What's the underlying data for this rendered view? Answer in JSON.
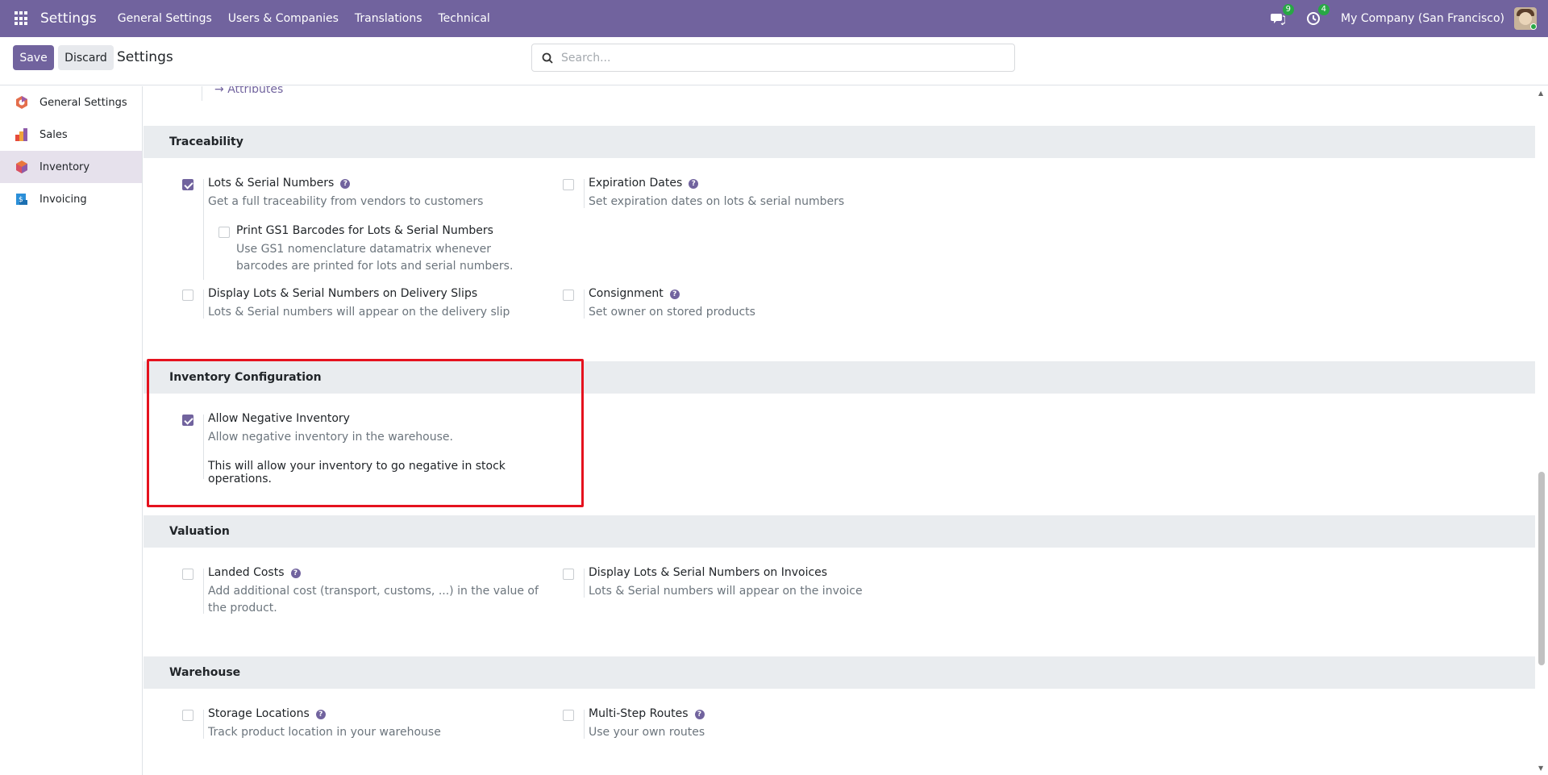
{
  "navbar": {
    "brand": "Settings",
    "menu": [
      "General Settings",
      "Users & Companies",
      "Translations",
      "Technical"
    ],
    "messages_count": "9",
    "activities_count": "4",
    "company": "My Company (San Francisco)",
    "colors": {
      "navbar_bg": "#71639e",
      "badge": "#28a745"
    }
  },
  "control": {
    "save_label": "Save",
    "discard_label": "Discard",
    "title": "Settings",
    "search_placeholder": "Search..."
  },
  "sidebar": {
    "items": [
      {
        "label": "General Settings",
        "icon": "odoo-logo-icon"
      },
      {
        "label": "Sales",
        "icon": "sales-chart-icon"
      },
      {
        "label": "Inventory",
        "icon": "inventory-box-icon",
        "active": true
      },
      {
        "label": "Invoicing",
        "icon": "invoice-icon"
      }
    ]
  },
  "content": {
    "attributes_link": "Attributes",
    "traceability": {
      "header": "Traceability",
      "lots": {
        "title": "Lots & Serial Numbers",
        "desc": "Get a full traceability from vendors to customers",
        "checked": true
      },
      "expiration": {
        "title": "Expiration Dates",
        "desc": "Set expiration dates on lots & serial numbers",
        "checked": false
      },
      "gs1": {
        "title": "Print GS1 Barcodes for Lots & Serial Numbers",
        "desc": "Use GS1 nomenclature datamatrix whenever barcodes are printed for lots and serial numbers.",
        "checked": false
      },
      "delivery_slips": {
        "title": "Display Lots & Serial Numbers on Delivery Slips",
        "desc": "Lots & Serial numbers will appear on the delivery slip",
        "checked": false
      },
      "consignment": {
        "title": "Consignment",
        "desc": "Set owner on stored products",
        "checked": false
      }
    },
    "inventory_config": {
      "header": "Inventory Configuration",
      "negative": {
        "title": "Allow Negative Inventory",
        "desc": "Allow negative inventory in the warehouse.",
        "extra": "This will allow your inventory to go negative in stock operations.",
        "checked": true
      }
    },
    "valuation": {
      "header": "Valuation",
      "landed": {
        "title": "Landed Costs",
        "desc": "Add additional cost (transport, customs, ...) in the value of the product.",
        "checked": false
      },
      "invoices": {
        "title": "Display Lots & Serial Numbers on Invoices",
        "desc": "Lots & Serial numbers will appear on the invoice",
        "checked": false
      }
    },
    "warehouse": {
      "header": "Warehouse",
      "storage": {
        "title": "Storage Locations",
        "desc": "Track product location in your warehouse",
        "checked": false
      },
      "multistep": {
        "title": "Multi-Step Routes",
        "desc": "Use your own routes",
        "checked": false
      }
    }
  }
}
